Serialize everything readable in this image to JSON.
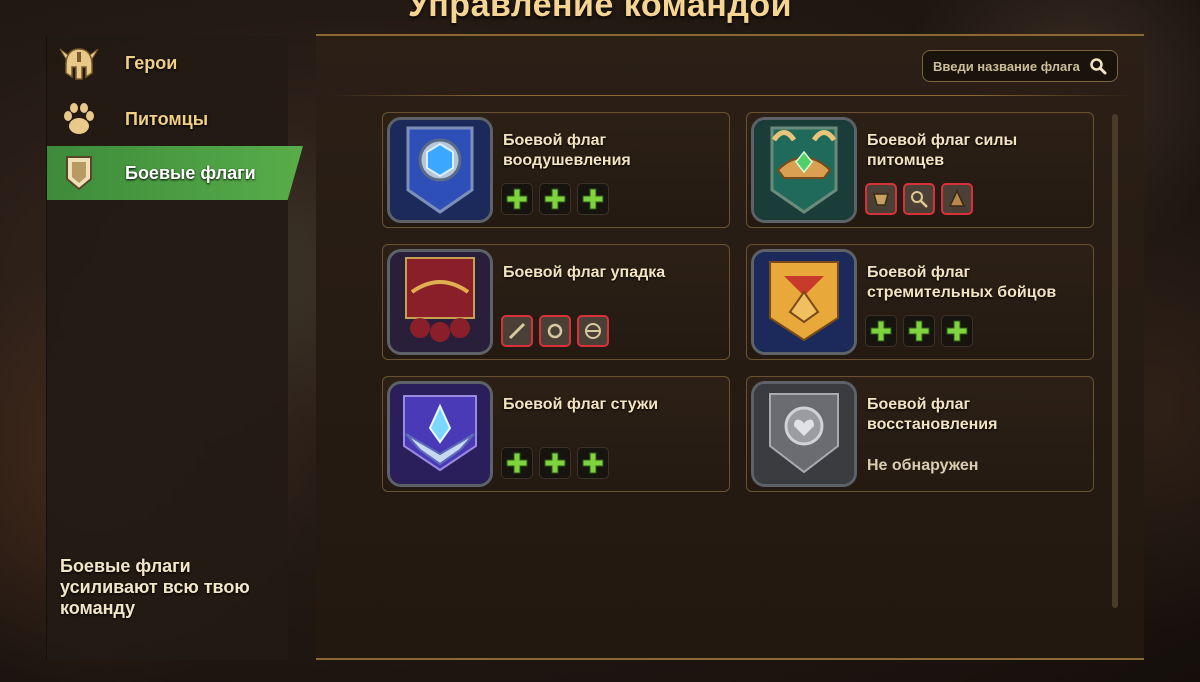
{
  "title": "Управление командой",
  "sidebar": {
    "items": [
      {
        "label": "Герои",
        "icon": "helmet-icon",
        "active": false
      },
      {
        "label": "Питомцы",
        "icon": "paw-icon",
        "active": false
      },
      {
        "label": "Боевые флаги",
        "icon": "banner-icon",
        "active": true
      }
    ],
    "description": "Боевые флаги усиливают всю твою команду"
  },
  "search": {
    "placeholder": "Введи название флага",
    "icon": "search-icon"
  },
  "colors": {
    "accent_green": "#4f9e44",
    "gold_text": "#f1cf86",
    "slot_red_border": "#d7323a",
    "plus_green": "#7ed33f"
  },
  "flags": [
    {
      "name": "Боевой флаг воодушевления",
      "icon": "inspiration-flag-icon",
      "slots": [
        "add",
        "add",
        "add"
      ]
    },
    {
      "name": "Боевой флаг силы питомцев",
      "icon": "pet-power-flag-icon",
      "slots": [
        "rune",
        "rune",
        "rune"
      ]
    },
    {
      "name": "Боевой флаг упадка",
      "icon": "decay-flag-icon",
      "slots": [
        "rune",
        "rune",
        "rune"
      ]
    },
    {
      "name": "Боевой флаг стремительных бойцов",
      "icon": "swift-fighters-flag-icon",
      "slots": [
        "add",
        "add",
        "add"
      ]
    },
    {
      "name": "Боевой флаг стужи",
      "icon": "frost-flag-icon",
      "slots": [
        "add",
        "add",
        "add"
      ]
    },
    {
      "name": "Боевой флаг восстановления",
      "icon": "restoration-flag-icon",
      "status": "Не обнаружен"
    }
  ]
}
